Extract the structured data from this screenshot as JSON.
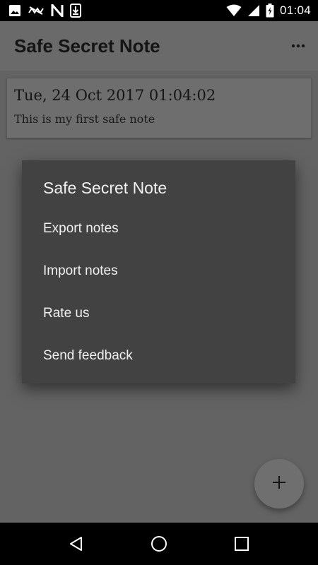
{
  "status_bar": {
    "time": "01:04",
    "icons": [
      "image-icon",
      "signal-off-icon",
      "network-n-icon",
      "download-icon",
      "wifi-icon",
      "cellular-icon",
      "battery-charging-icon"
    ]
  },
  "app_bar": {
    "title": "Safe Secret Note",
    "overflow_icon": "more-horizontal-icon"
  },
  "notes": [
    {
      "date": "Tue, 24 Oct 2017 01:04:02",
      "text": "This is my first safe note"
    }
  ],
  "menu": {
    "title": "Safe Secret Note",
    "items": [
      {
        "label": "Export notes"
      },
      {
        "label": "Import notes"
      },
      {
        "label": "Rate us"
      },
      {
        "label": "Send feedback"
      }
    ]
  },
  "fab": {
    "icon": "plus-icon"
  },
  "nav_bar": {
    "icons": [
      "back-icon",
      "home-icon",
      "recents-icon"
    ]
  }
}
